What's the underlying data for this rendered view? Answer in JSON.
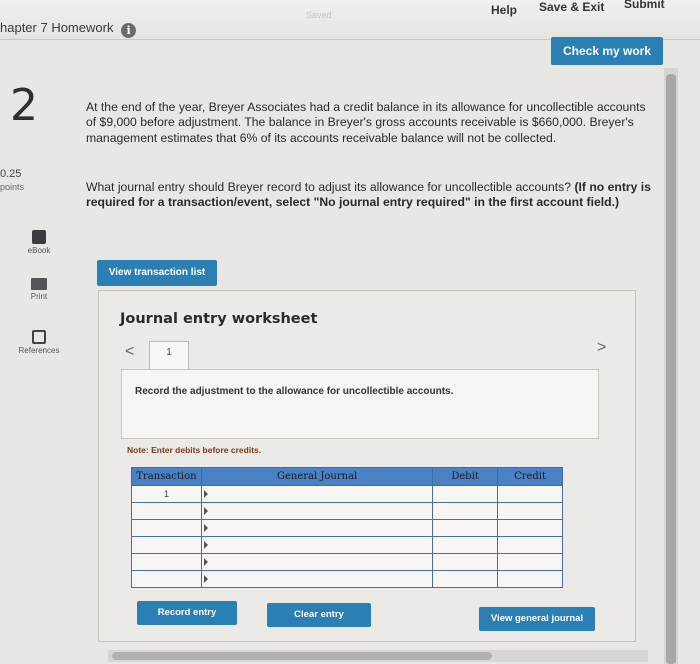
{
  "header": {
    "chapter_title": "hapter 7 Homework",
    "saved_text": "Saved",
    "help": "Help",
    "save_exit": "Save & Exit",
    "submit": "Submit",
    "check_my_work": "Check my work"
  },
  "question": {
    "number": "2",
    "points_value": "0.25",
    "points_label": "points",
    "body": "At the end of the year, Breyer Associates had a credit balance in its allowance for uncollectible accounts of $9,000 before adjustment. The balance in Breyer's gross accounts receivable is $660,000. Breyer's management estimates that 6% of its accounts receivable balance will not be collected.",
    "prompt_normal": "What journal entry should Breyer record to adjust its allowance for uncollectible accounts? ",
    "prompt_bold": "(If no entry is required for a transaction/event, select \"No journal entry required\" in the first account field.)"
  },
  "sidebar": {
    "ebook": "eBook",
    "print": "Print",
    "references": "References"
  },
  "view_transaction_list": "View transaction list",
  "worksheet": {
    "title": "Journal entry worksheet",
    "nav_prev": "<",
    "nav_next": ">",
    "tab_label": "1",
    "instruction": "Record the adjustment to the allowance for uncollectible accounts.",
    "note": "Note: Enter debits before credits.",
    "columns": [
      "Transaction",
      "General Journal",
      "Debit",
      "Credit"
    ],
    "rows": [
      {
        "transaction": "1",
        "account": "",
        "debit": "",
        "credit": ""
      },
      {
        "transaction": "",
        "account": "",
        "debit": "",
        "credit": ""
      },
      {
        "transaction": "",
        "account": "",
        "debit": "",
        "credit": ""
      },
      {
        "transaction": "",
        "account": "",
        "debit": "",
        "credit": ""
      },
      {
        "transaction": "",
        "account": "",
        "debit": "",
        "credit": ""
      },
      {
        "transaction": "",
        "account": "",
        "debit": "",
        "credit": ""
      }
    ],
    "record_entry": "Record entry",
    "clear_entry": "Clear entry",
    "view_general_journal": "View general journal"
  },
  "colors": {
    "button_blue": "#2a7fb5",
    "table_header": "#4a80c4",
    "note_color": "#7a3a14"
  },
  "icons": [
    "info-icon",
    "ebook-icon",
    "print-icon",
    "references-icon",
    "dropdown-arrow-icon"
  ]
}
